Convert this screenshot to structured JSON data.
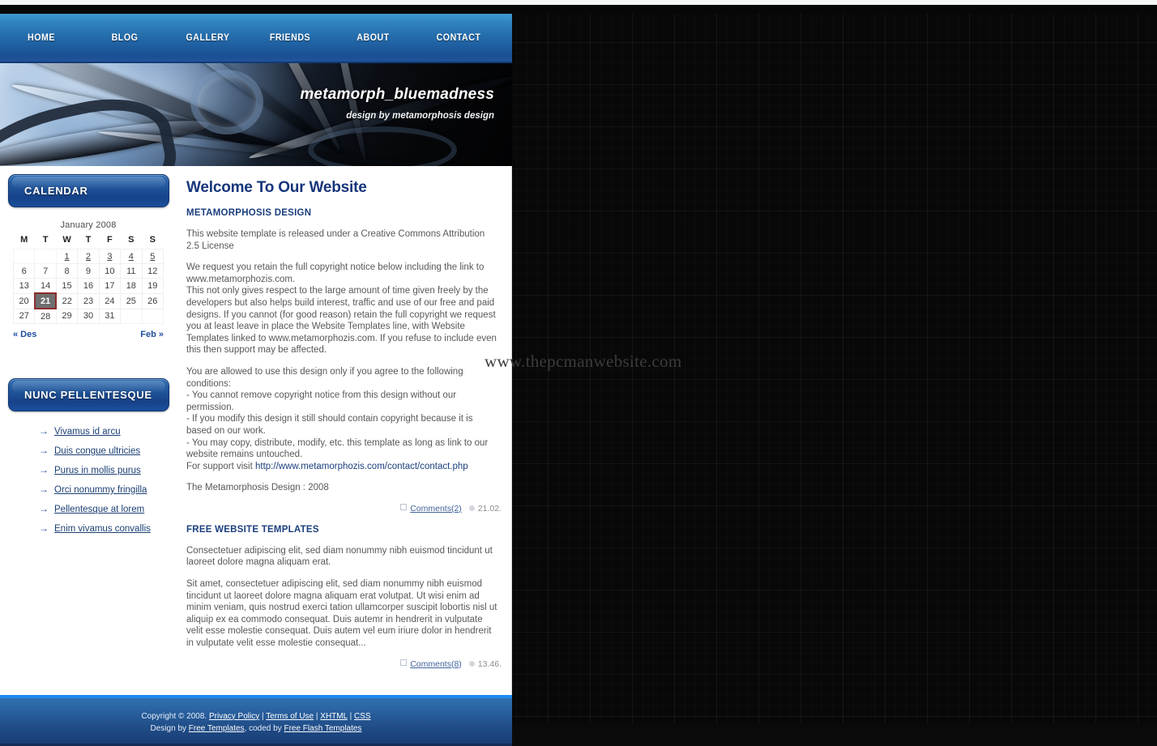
{
  "watermark": "www.thepcmanwebsite.com",
  "nav": {
    "items": [
      {
        "label": "HOME"
      },
      {
        "label": "BLOG"
      },
      {
        "label": "GALLERY"
      },
      {
        "label": "FRIENDS"
      },
      {
        "label": "ABOUT"
      },
      {
        "label": "CONTACT"
      }
    ]
  },
  "hero": {
    "title": "metamorph_bluemadness",
    "subtitle": "design by metamorphosis design"
  },
  "sidebar": {
    "calendar": {
      "heading": "CALENDAR",
      "month_label": "January 2008",
      "weekday_headers": [
        "M",
        "T",
        "W",
        "T",
        "F",
        "S",
        "S"
      ],
      "weeks": [
        [
          "",
          "",
          "1",
          "2",
          "3",
          "4",
          "5"
        ],
        [
          "6",
          "7",
          "8",
          "9",
          "10",
          "11",
          "12"
        ],
        [
          "13",
          "14",
          "15",
          "16",
          "17",
          "18",
          "19"
        ],
        [
          "20",
          "21",
          "22",
          "23",
          "24",
          "25",
          "26"
        ],
        [
          "27",
          "28",
          "29",
          "30",
          "31",
          "",
          ""
        ]
      ],
      "linked_days": [
        "1",
        "2",
        "3",
        "4",
        "5"
      ],
      "today": "21",
      "prev_label": "« Des",
      "next_label": "Feb »",
      "today_border_color": "#8d2b2b"
    },
    "links_widget": {
      "heading": "NUNC PELLENTESQUE",
      "arrow_glyph": "→",
      "items": [
        {
          "label": "Vivamus id arcu"
        },
        {
          "label": "Duis congue ultricies"
        },
        {
          "label": "Purus in mollis purus"
        },
        {
          "label": "Orci nonummy fringilla"
        },
        {
          "label": "Pellentesque at lorem"
        },
        {
          "label": "Enim vivamus convallis"
        }
      ]
    }
  },
  "content": {
    "page_title": "Welcome To Our Website",
    "articles": [
      {
        "title": "METAMORPHOSIS DESIGN",
        "paragraphs": [
          "This website template is released under a Creative Commons Attribution 2.5 License",
          "We request you retain the full copyright notice below including the link to www.metamorphozis.com.\nThis not only gives respect to the large amount of time given freely by the developers but also helps build interest, traffic and use of our free and paid designs. If you cannot (for good reason) retain the full copyright we request you at least leave in place the Website Templates line, with Website Templates linked to www.metamorphozis.com. If you refuse to include even this then support may be affected.",
          "You are allowed to use this design only if you agree to the following conditions:\n- You cannot remove copyright notice from this design without our permission.\n- If you modify this design it still should contain copyright because it is based on our work.\n- You may copy, distribute, modify, etc. this template as long as link to our website remains untouched.",
          "The Metamorphosis Design : 2008"
        ],
        "support_prefix": "For support visit ",
        "support_link": "http://www.metamorphozis.com/contact/contact.php",
        "comments_label": "Comments(2)",
        "time_label": "21.02."
      },
      {
        "title": "FREE WEBSITE TEMPLATES",
        "paragraphs": [
          "Consectetuer adipiscing elit, sed diam nonummy nibh euismod tincidunt ut laoreet dolore magna aliquam erat.",
          "Sit amet, consectetuer adipiscing elit, sed diam nonummy nibh euismod tincidunt ut laoreet dolore magna aliquam erat volutpat. Ut wisi enim ad minim veniam, quis nostrud exerci tation ullamcorper suscipit lobortis nisl ut aliquip ex ea commodo consequat. Duis autemr in hendrerit in vulputate velit esse molestie consequat. Duis autem vel eum iriure dolor in hendrerit in vulputate velit esse molestie consequat..."
        ],
        "comments_label": "Comments(8)",
        "time_label": "13.46."
      }
    ]
  },
  "footer": {
    "copyright": "Copyright © 2008.",
    "links": [
      {
        "label": "Privacy Policy"
      },
      {
        "label": "Terms of Use"
      },
      {
        "label": "XHTML"
      },
      {
        "label": "CSS"
      }
    ],
    "separator": "|",
    "design_prefix": "Design by ",
    "design_link": "Free Templates",
    "coded_prefix": ", coded by ",
    "coded_link": "Free Flash Templates"
  }
}
